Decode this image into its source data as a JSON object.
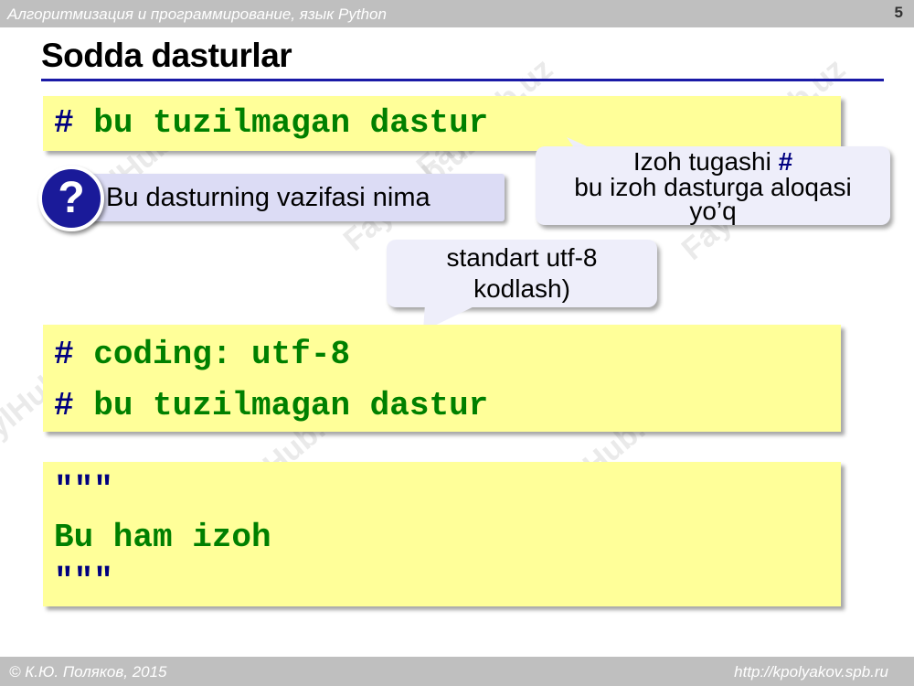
{
  "header": {
    "course": "Алгоритмизация и программирование, язык Python",
    "page_number": "5"
  },
  "slide": {
    "title": "Sodda dasturlar",
    "code1": {
      "hash": "#",
      "text": " bu tuzilmagan dastur"
    },
    "question": "Bu dasturning vazifasi nima",
    "question_icon": "?",
    "callout_comment": {
      "line1": "Izoh tugashi ",
      "line1_hash": "#",
      "line2": "bu izoh dasturga aloqasi",
      "line3": "yo’q"
    },
    "callout_encoding": {
      "line1": "standart utf-8",
      "line2": "kodlash)"
    },
    "code2": {
      "line1_hash": "#",
      "line1_text": " coding: utf-8",
      "line2_hash": "#",
      "line2_text": " bu tuzilmagan dastur"
    },
    "code3": {
      "line1": "\"\"\"",
      "line2": "Bu ham izoh",
      "line3": "\"\"\""
    }
  },
  "footer": {
    "copyright": "© К.Ю. Поляков, 2015",
    "url": "http://kpolyakov.spb.ru"
  },
  "watermark": "FaylHub.uz",
  "colors": {
    "code_bg": "#ffff99",
    "code_text": "#008000",
    "hash": "#000080",
    "title_rule": "#1a1aa6",
    "callout_bg": "#eeeefa"
  }
}
